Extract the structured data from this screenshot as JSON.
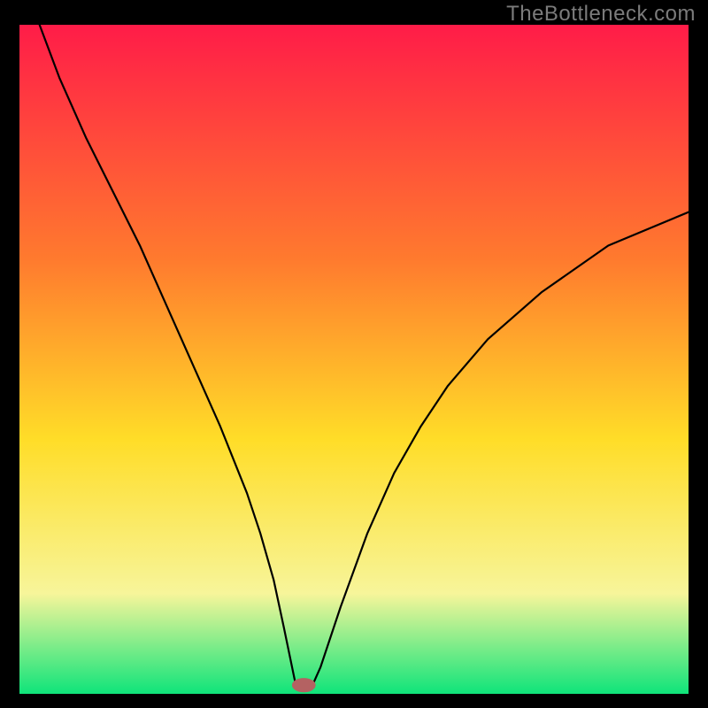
{
  "watermark": "TheBottleneck.com",
  "colors": {
    "grad_top": "#ff1c48",
    "grad_mid_upper": "#ff7a2e",
    "grad_mid": "#ffdd28",
    "grad_lower": "#f7f59a",
    "grad_bottom": "#0fe47a",
    "curve": "#000000",
    "marker": "#b46262",
    "frame": "#000000"
  },
  "chart_data": {
    "type": "line",
    "title": "",
    "xlabel": "",
    "ylabel": "",
    "xlim": [
      0,
      100
    ],
    "ylim": [
      0,
      100
    ],
    "series": [
      {
        "name": "curve",
        "x": [
          3,
          6,
          10,
          14,
          18,
          22,
          26,
          30,
          34,
          36,
          38,
          39.5,
          41.3,
          42,
          43.8,
          45,
          48,
          52,
          56,
          60,
          64,
          70,
          78,
          88,
          100
        ],
        "values": [
          100,
          92,
          83,
          75,
          67,
          58,
          49,
          40,
          30,
          24,
          17,
          10,
          1.3,
          1.3,
          1.3,
          4,
          13,
          24,
          33,
          40,
          46,
          53,
          60,
          67,
          72
        ]
      }
    ],
    "marker": {
      "x": 42.5,
      "y": 1.3,
      "rx": 1.7,
      "ry": 1.0
    },
    "grid": false,
    "legend": false
  }
}
